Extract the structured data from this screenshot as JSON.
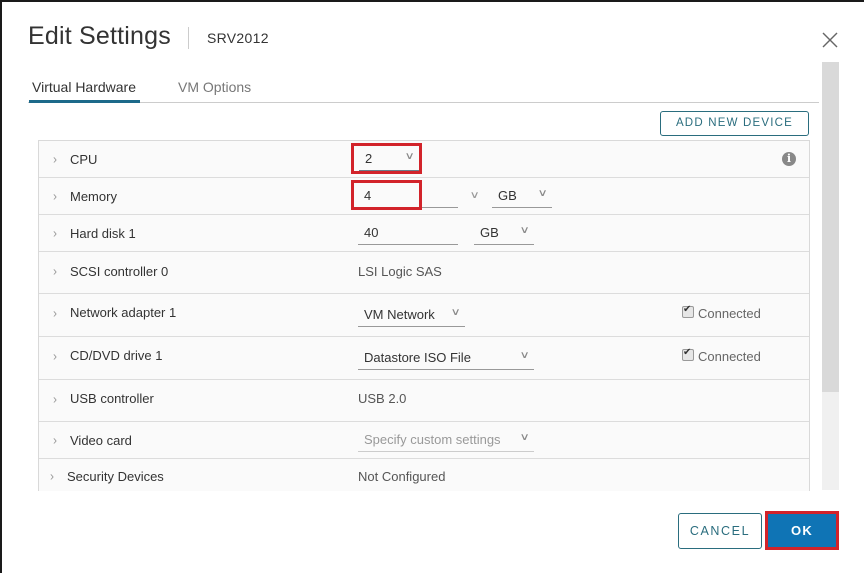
{
  "dialog": {
    "title": "Edit Settings",
    "vm_name": "SRV2012",
    "close_icon": "close-icon"
  },
  "tabs": [
    {
      "label": "Virtual Hardware",
      "active": true
    },
    {
      "label": "VM Options",
      "active": false
    }
  ],
  "toolbar": {
    "add_new_device_label": "ADD NEW DEVICE"
  },
  "hardware": {
    "cpu": {
      "label": "CPU",
      "value": "2"
    },
    "memory": {
      "label": "Memory",
      "value": "4",
      "unit": "GB"
    },
    "hard_disk": {
      "label": "Hard disk 1",
      "value": "40",
      "unit": "GB"
    },
    "scsi": {
      "label": "SCSI controller 0",
      "value": "LSI Logic SAS"
    },
    "network": {
      "label": "Network adapter 1",
      "value": "VM Network",
      "connected_label": "Connected",
      "connected": true
    },
    "cddvd": {
      "label": "CD/DVD drive 1",
      "value": "Datastore ISO File",
      "connected_label": "Connected",
      "connected": true
    },
    "usb": {
      "label": "USB controller",
      "value": "USB 2.0"
    },
    "video": {
      "label": "Video card",
      "value": "Specify custom settings"
    },
    "security": {
      "label": "Security Devices",
      "value": "Not Configured"
    }
  },
  "icons": {
    "chevron": "›",
    "dropdown": "∨",
    "info": "i",
    "close": "×"
  },
  "footer": {
    "cancel_label": "CANCEL",
    "ok_label": "OK"
  },
  "colors": {
    "accent": "#0f74b5",
    "teal_outline": "#2a6d7e",
    "highlight_red": "#d2232a",
    "tab_underline": "#1d6a8a"
  }
}
